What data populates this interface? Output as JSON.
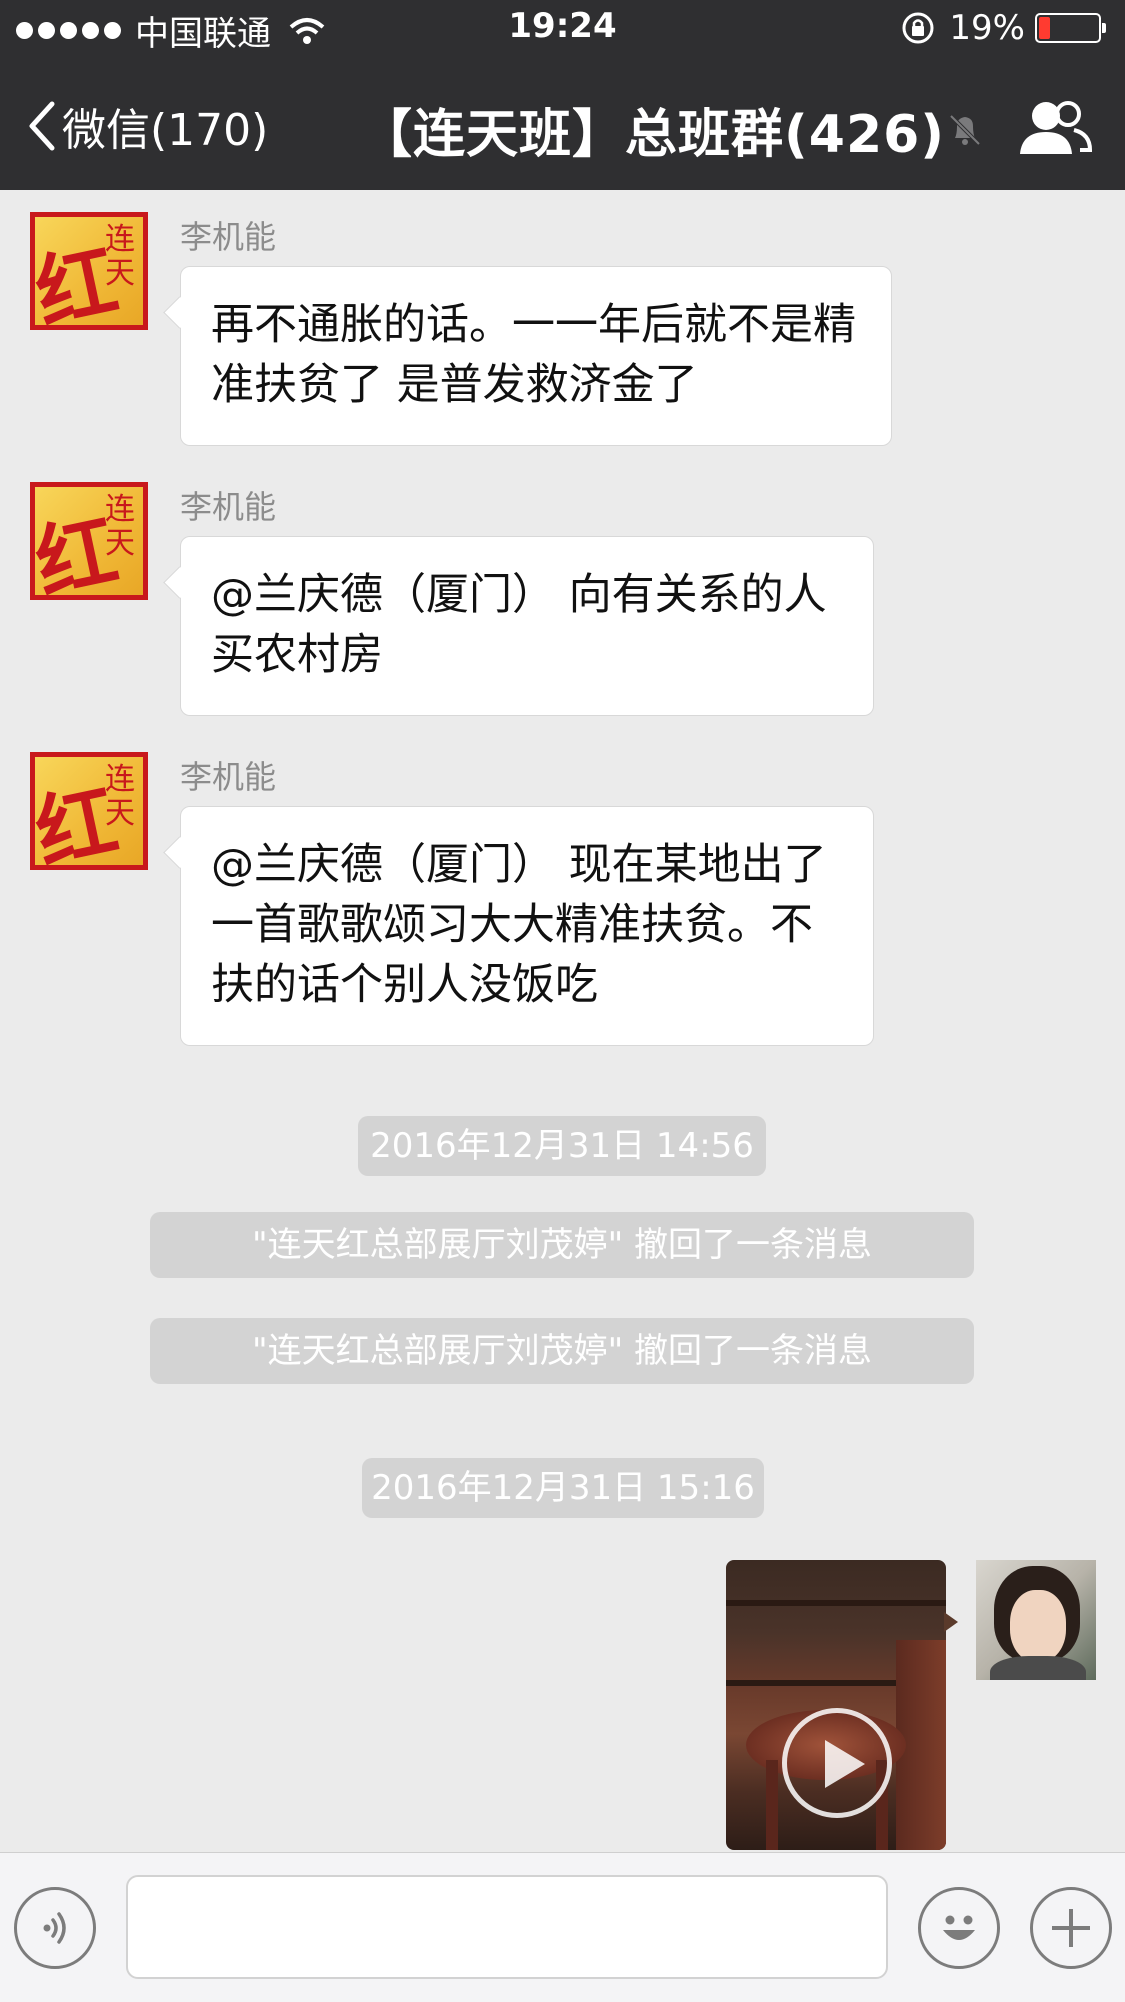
{
  "status_bar": {
    "carrier": "中国联通",
    "time": "19:24",
    "battery": "19%",
    "battery_level": 0.19
  },
  "nav": {
    "back_label": "微信(170)",
    "title": "【连天班】总班群(426)"
  },
  "messages": [
    {
      "sender": "李机能",
      "text": "再不通胀的话。一一年后就不是精准扶贫了 是普发救济金了"
    },
    {
      "sender": "李机能",
      "text": "@兰庆德（厦门） 向有关系的人买农村房"
    },
    {
      "sender": "李机能",
      "text": "@兰庆德（厦门） 现在某地出了一首歌歌颂习大大精准扶贫。不扶的话个别人没饭吃"
    }
  ],
  "system": {
    "time1": "2016年12月31日 14:56",
    "recall1": "\"连天红总部展厅刘茂婷\" 撤回了一条消息",
    "recall2": "\"连天红总部展厅刘茂婷\" 撤回了一条消息",
    "time2": "2016年12月31日 15:16"
  },
  "avatar_logo": {
    "main": "红",
    "sub": "连天"
  },
  "colors": {
    "nav_bg": "#2f2f31",
    "chat_bg": "#ebebeb",
    "pill_bg": "#d3d3d3",
    "battery_low": "#ff3b30"
  },
  "icons": {
    "back": "chevron-left-icon",
    "mute": "bell-slash-icon",
    "members": "people-icon",
    "voice": "voice-icon",
    "emoji": "smiley-icon",
    "more": "plus-icon",
    "play": "play-icon"
  }
}
